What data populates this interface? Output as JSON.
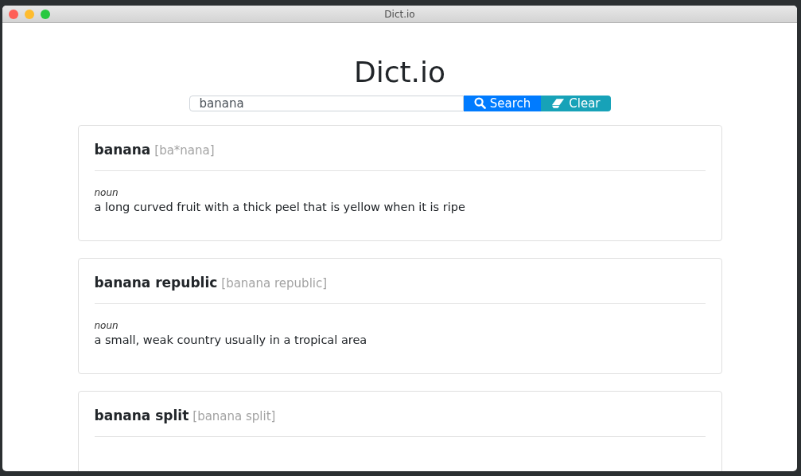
{
  "window": {
    "title": "Dict.io"
  },
  "heading": "Dict.io",
  "search": {
    "value": "banana",
    "buttons": [
      {
        "kind": "search",
        "label": "Search"
      },
      {
        "kind": "clear",
        "label": "Clear"
      }
    ]
  },
  "entries": [
    {
      "word": "banana",
      "pronunciation": "[ba*nana]",
      "pos": "noun",
      "definition": "a long curved fruit with a thick peel that is yellow when it is ripe"
    },
    {
      "word": "banana republic",
      "pronunciation": "[banana republic]",
      "pos": "noun",
      "definition": "a small, weak country usually in a tropical area"
    },
    {
      "word": "banana split",
      "pronunciation": "[banana split]"
    }
  ]
}
